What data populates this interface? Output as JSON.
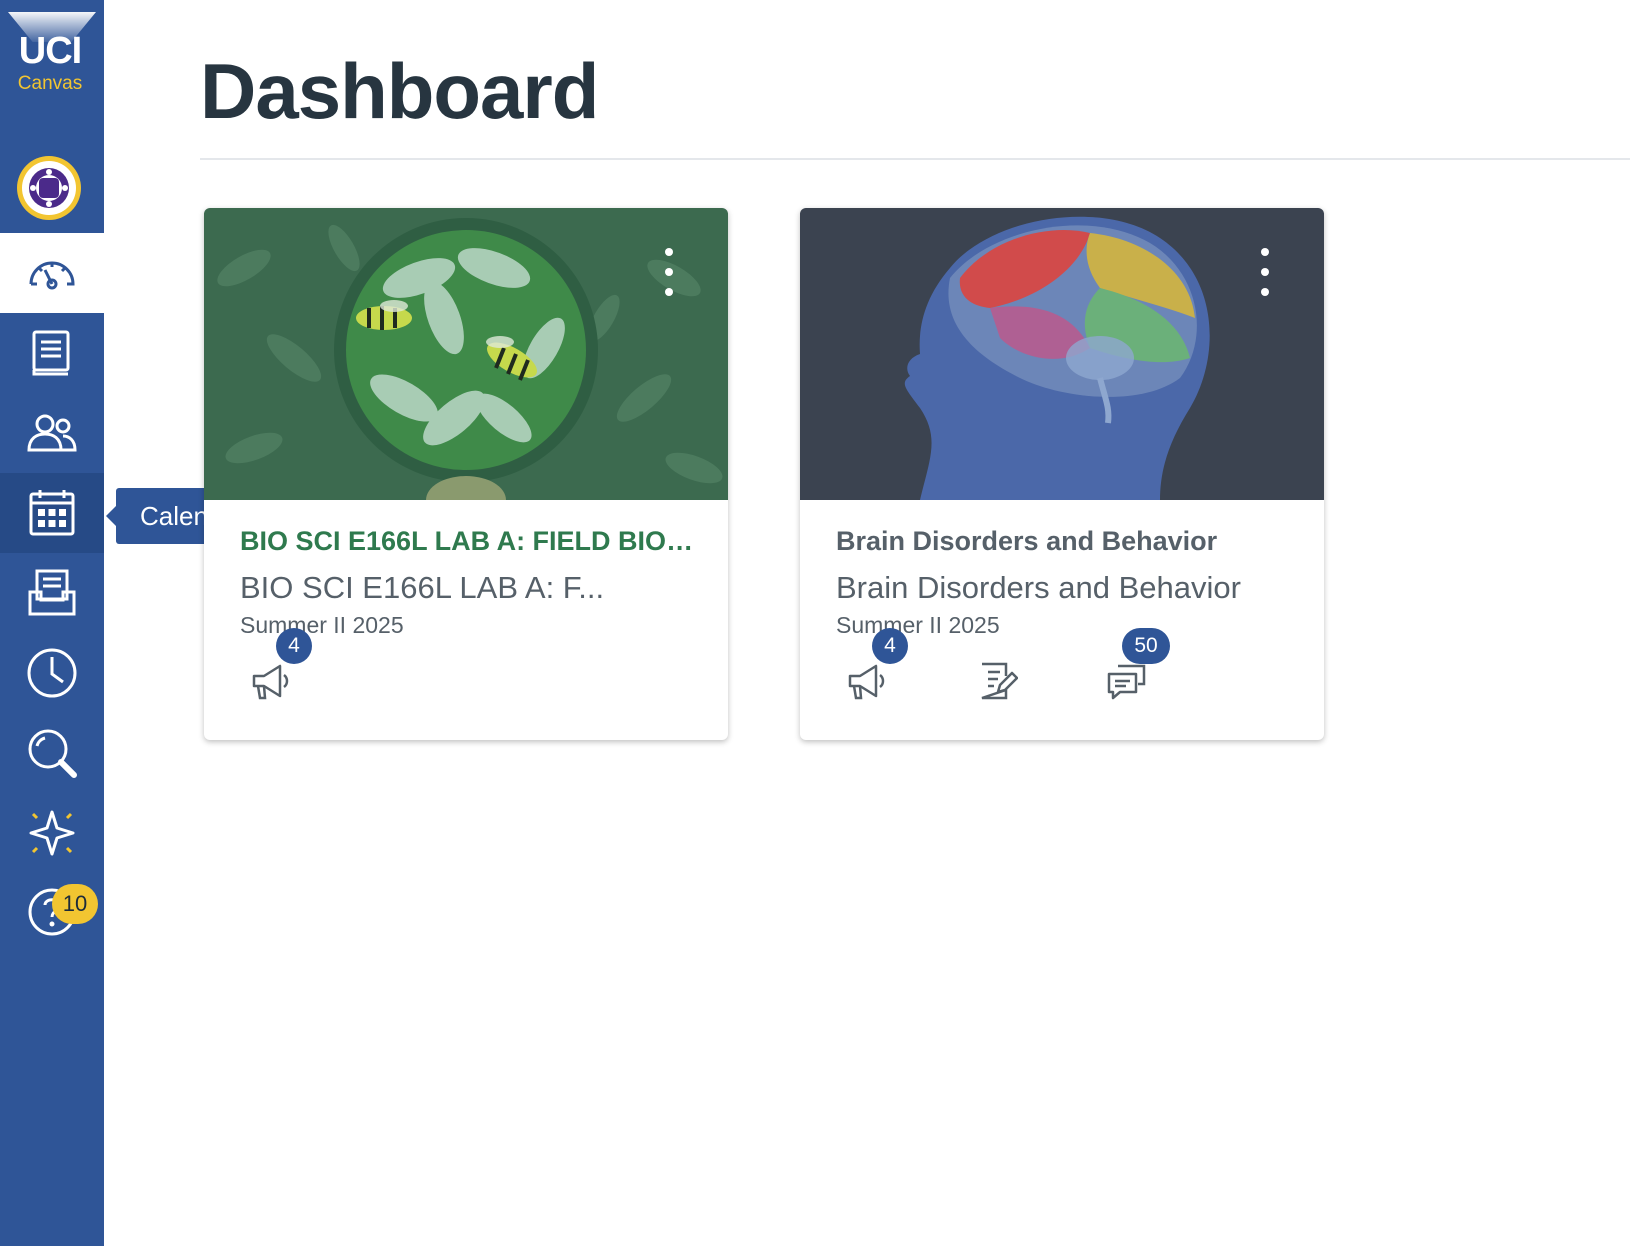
{
  "app": {
    "logo_text": "UCI",
    "logo_subtext": "Canvas"
  },
  "sidebar": {
    "items": [
      {
        "name": "dashboard",
        "icon": "dashboard-gauge-icon"
      },
      {
        "name": "courses",
        "icon": "courses-book-icon"
      },
      {
        "name": "groups",
        "icon": "groups-people-icon"
      },
      {
        "name": "calendar",
        "icon": "calendar-icon"
      },
      {
        "name": "inbox",
        "icon": "inbox-tray-icon"
      },
      {
        "name": "history",
        "icon": "clock-icon"
      },
      {
        "name": "search",
        "icon": "search-icon"
      },
      {
        "name": "new-features",
        "icon": "sparkle-star-icon"
      },
      {
        "name": "help",
        "icon": "help-question-icon"
      }
    ],
    "tooltip": "Calendar",
    "help_badge": "10",
    "colors": {
      "sidebar": "#2f5597",
      "accent": "#f2c531"
    }
  },
  "page": {
    "title": "Dashboard"
  },
  "cards": [
    {
      "title": "BIO SCI E166L LAB A: FIELD BIOL...",
      "title_color": "#2f7a4e",
      "code": "BIO SCI E166L LAB A: F...",
      "term": "Summer II 2025",
      "announcements_count": "4",
      "image": "bees-on-flowers-illustration"
    },
    {
      "title": "Brain Disorders and Behavior",
      "title_color": "#566069",
      "code": "Brain Disorders and Behavior",
      "term": "Summer II 2025",
      "announcements_count": "4",
      "discussions_count": "50",
      "image": "human-head-brain-illustration"
    }
  ]
}
